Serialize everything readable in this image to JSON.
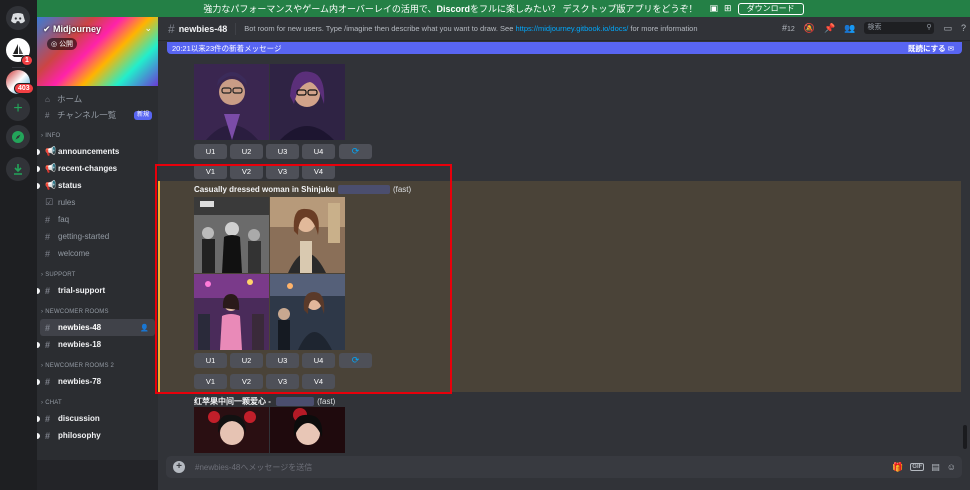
{
  "banner": {
    "text_pre": "強力なパフォーマンスやゲーム内オーバーレイの活用で、",
    "text_brand": "Discord",
    "text_post": "をフルに楽しみたい？ デスクトップ版アプリをどうぞ！",
    "download_label": "ダウンロード",
    "platform_icons": [
      "apple-icon",
      "android-icon",
      "windows-icon"
    ]
  },
  "rail": {
    "home_badge": "1",
    "server2_badge": "403"
  },
  "server": {
    "name": "Midjourney",
    "public_label": "公開",
    "nav": [
      {
        "icon": "home-icon",
        "label": "ホーム"
      },
      {
        "icon": "channels-icon",
        "label": "チャンネル一覧",
        "badge": "新規"
      }
    ]
  },
  "categories": [
    {
      "name": "INFO",
      "channels": [
        {
          "icon": "megaphone-icon",
          "label": "announcements",
          "bold": true,
          "dot": true
        },
        {
          "icon": "megaphone-icon",
          "label": "recent-changes",
          "bold": true,
          "dot": true
        },
        {
          "icon": "megaphone-icon",
          "label": "status",
          "bold": true,
          "dot": true
        },
        {
          "icon": "rules-icon",
          "label": "rules"
        },
        {
          "icon": "hash-icon",
          "label": "faq"
        },
        {
          "icon": "hash-icon",
          "label": "getting-started"
        },
        {
          "icon": "hash-icon",
          "label": "welcome"
        }
      ]
    },
    {
      "name": "SUPPORT",
      "channels": [
        {
          "icon": "hash-icon",
          "label": "trial-support",
          "bold": true,
          "dot": true
        }
      ]
    },
    {
      "name": "NEWCOMER ROOMS",
      "channels": [
        {
          "icon": "threads-icon",
          "label": "newbies-48",
          "active": true
        },
        {
          "icon": "threads-icon",
          "label": "newbies-18",
          "bold": true,
          "dot": true
        }
      ]
    },
    {
      "name": "NEWCOMER ROOMS 2",
      "channels": [
        {
          "icon": "threads-icon",
          "label": "newbies-78",
          "bold": true,
          "dot": true
        }
      ]
    },
    {
      "name": "CHAT",
      "channels": [
        {
          "icon": "hash-icon",
          "label": "discussion",
          "bold": true,
          "dot": true
        },
        {
          "icon": "hash-icon",
          "label": "philosophy",
          "bold": true,
          "dot": true
        }
      ]
    }
  ],
  "channel_header": {
    "name": "newbies-48",
    "topic_pre": "Bot room for new users. Type /imagine then describe what you want to draw. See ",
    "topic_link": "https://midjourney.gitbook.io/docs/",
    "topic_post": " for more information",
    "threads_count": "12",
    "search_placeholder": "検索"
  },
  "new_messages": {
    "text": "20:21以来23件の新着メッセージ",
    "mark_read": "既読にする"
  },
  "messages": [
    {
      "title": "",
      "upscale": [
        "U1",
        "U2",
        "U3",
        "U4"
      ],
      "variation": [
        "V1",
        "V2",
        "V3",
        "V4"
      ]
    },
    {
      "title": "Casually dressed woman in Shinjuku",
      "speed": "(fast)",
      "upscale": [
        "U1",
        "U2",
        "U3",
        "U4"
      ],
      "variation": [
        "V1",
        "V2",
        "V3",
        "V4"
      ]
    },
    {
      "title": "红苹果中间一颗爱心 - ",
      "speed": "(fast)"
    }
  ],
  "composer": {
    "placeholder": "#newbies-48へメッセージを送信"
  }
}
